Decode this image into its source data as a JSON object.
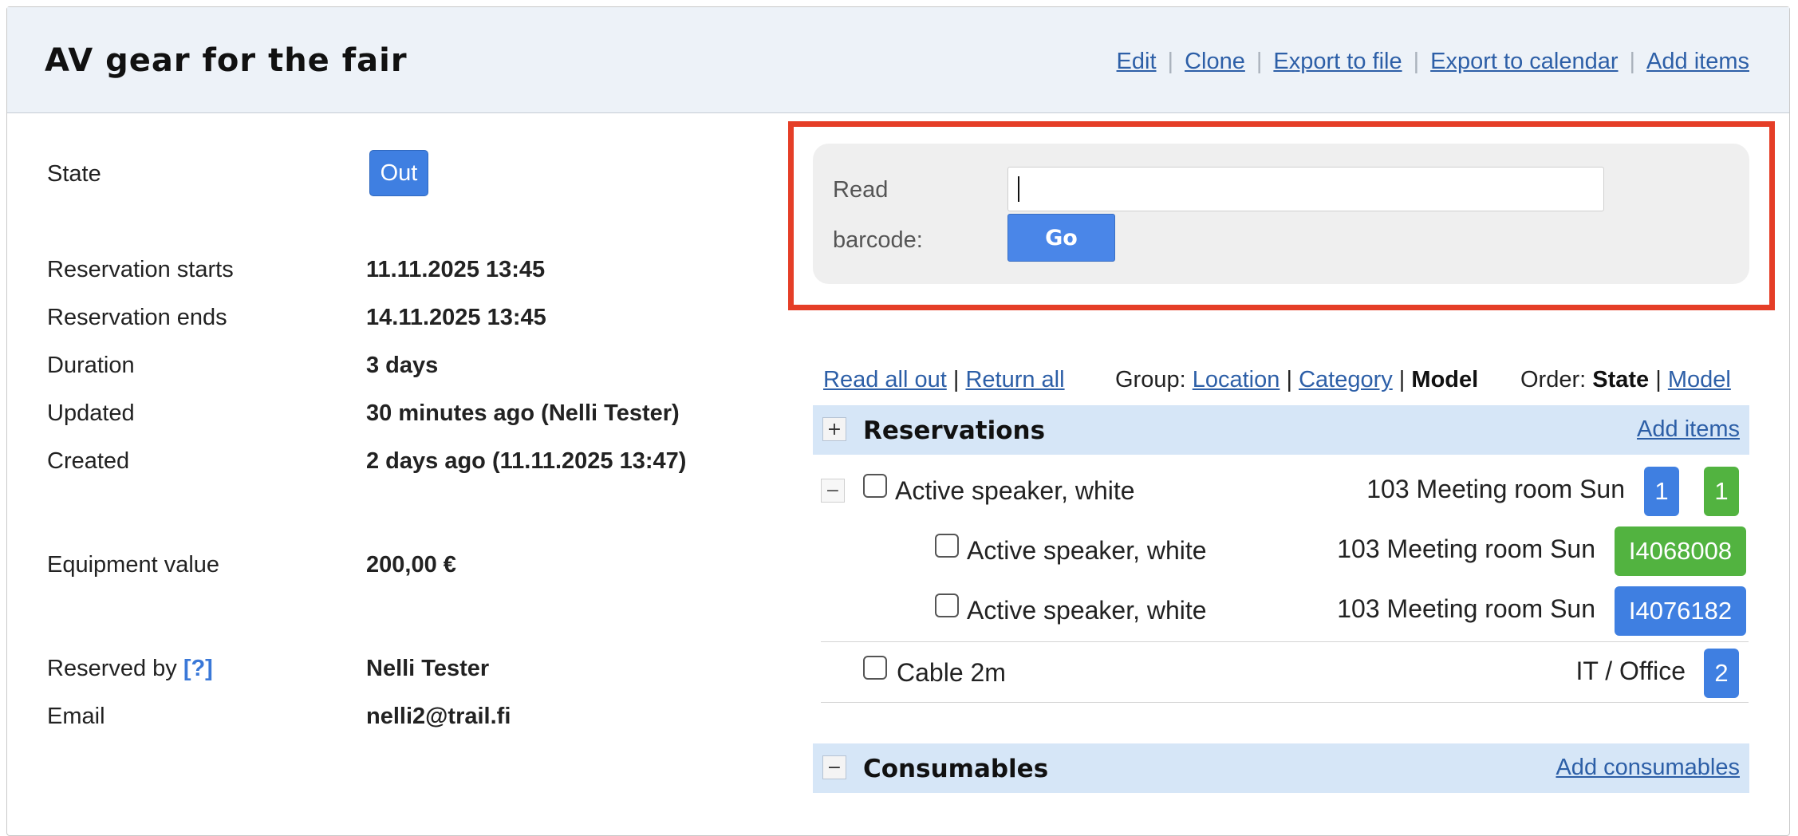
{
  "page_title": "AV gear for the fair",
  "header_links": {
    "edit": "Edit",
    "clone": "Clone",
    "export_file": "Export to file",
    "export_calendar": "Export to calendar",
    "add_items": "Add items",
    "sep": "|"
  },
  "details": {
    "state_label": "State",
    "state_value": "Out",
    "starts_label": "Reservation starts",
    "starts_value": "11.11.2025 13:45",
    "ends_label": "Reservation ends",
    "ends_value": "14.11.2025 13:45",
    "duration_label": "Duration",
    "duration_value": "3 days",
    "updated_label": "Updated",
    "updated_value": "30 minutes ago (Nelli Tester)",
    "created_label": "Created",
    "created_value": "2 days ago (11.11.2025 13:47)",
    "equipment_label": "Equipment value",
    "equipment_value": "200,00 €",
    "reserved_by_label": "Reserved by",
    "reserved_by_help": "[?]",
    "reserved_by_value": "Nelli Tester",
    "email_label": "Email",
    "email_value": "nelli2@trail.fi"
  },
  "barcode": {
    "label_line1": "Read",
    "label_line2": "barcode:",
    "input_value": "",
    "go_label": "Go"
  },
  "toolbar": {
    "read_all_out": "Read all out",
    "return_all": "Return all",
    "sep": "|",
    "group_label": "Group:",
    "group_location": "Location",
    "group_category": "Category",
    "group_model": "Model",
    "order_label": "Order:",
    "order_state": "State",
    "order_model": "Model"
  },
  "reservations": {
    "toggle": "+",
    "title": "Reservations",
    "add_link": "Add items",
    "items": [
      {
        "toggle": "−",
        "name": "Active speaker, white",
        "location": "103 Meeting room Sun",
        "badge_blue": "1",
        "badge_green": "1",
        "children": [
          {
            "name": "Active speaker, white",
            "location": "103 Meeting room Sun",
            "code": "I4068008",
            "code_color": "#52b340"
          },
          {
            "name": "Active speaker, white",
            "location": "103 Meeting room Sun",
            "code": "I4076182",
            "code_color": "#3f7fe1"
          }
        ]
      },
      {
        "name": "Cable 2m",
        "location": "IT / Office",
        "badge_blue": "2"
      }
    ]
  },
  "consumables": {
    "toggle": "−",
    "title": "Consumables",
    "add_link": "Add consumables"
  },
  "colors": {
    "blue_badge": "#3f7fe1",
    "green_badge": "#52b340",
    "highlight_border": "#e53e27",
    "group_header_bg": "#d6e6f7"
  }
}
